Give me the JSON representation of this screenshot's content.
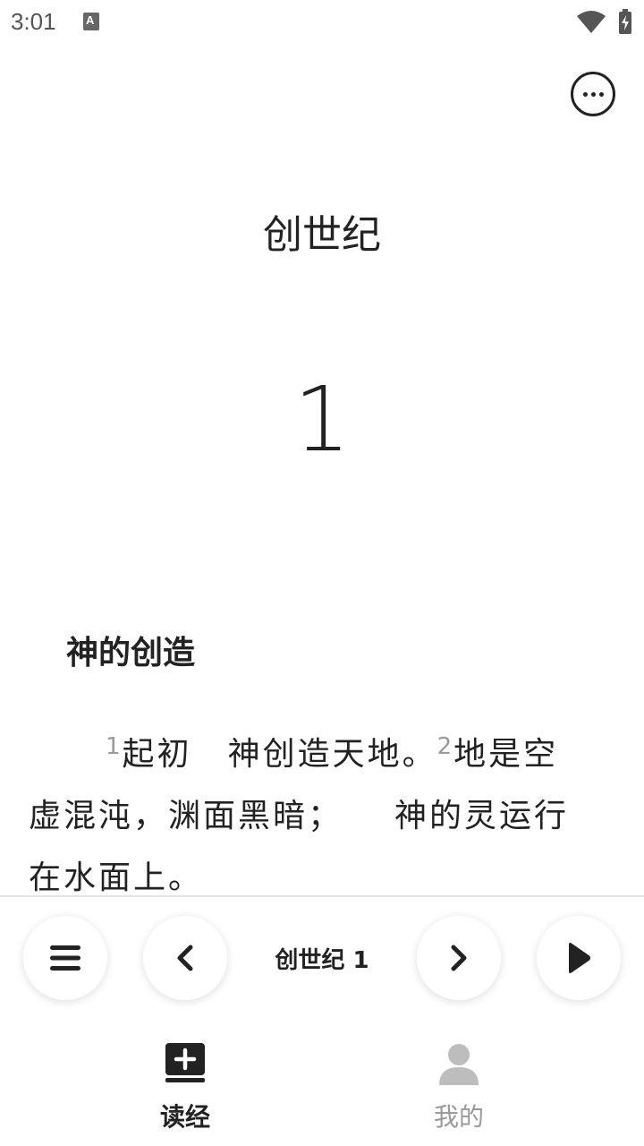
{
  "status_bar": {
    "time": "3:01",
    "notification_icon": "A"
  },
  "header": {
    "more_icon": "more-horizontal-icon"
  },
  "reader": {
    "book_title": "创世纪",
    "chapter_number": "1",
    "section_heading": "神的创造",
    "verses": [
      {
        "number": "1",
        "part1": "起初",
        "part2": "神创造天地。"
      },
      {
        "number": "2",
        "line1": "地是空",
        "line2a": "虚混沌，渊面黑暗；",
        "line2b": "神的灵运行",
        "line3": "在水面上。"
      }
    ]
  },
  "controls": {
    "menu_icon": "menu-icon",
    "prev_icon": "chevron-left-icon",
    "chapter_label": "创世纪 1",
    "next_icon": "chevron-right-icon",
    "play_icon": "play-icon"
  },
  "bottom_nav": {
    "items": [
      {
        "label": "读经",
        "icon": "bible-add-icon",
        "active": true
      },
      {
        "label": "我的",
        "icon": "person-icon",
        "active": false
      }
    ]
  },
  "colors": {
    "text": "#222222",
    "muted": "#9a9a9a",
    "divider": "#e3e3e3"
  }
}
